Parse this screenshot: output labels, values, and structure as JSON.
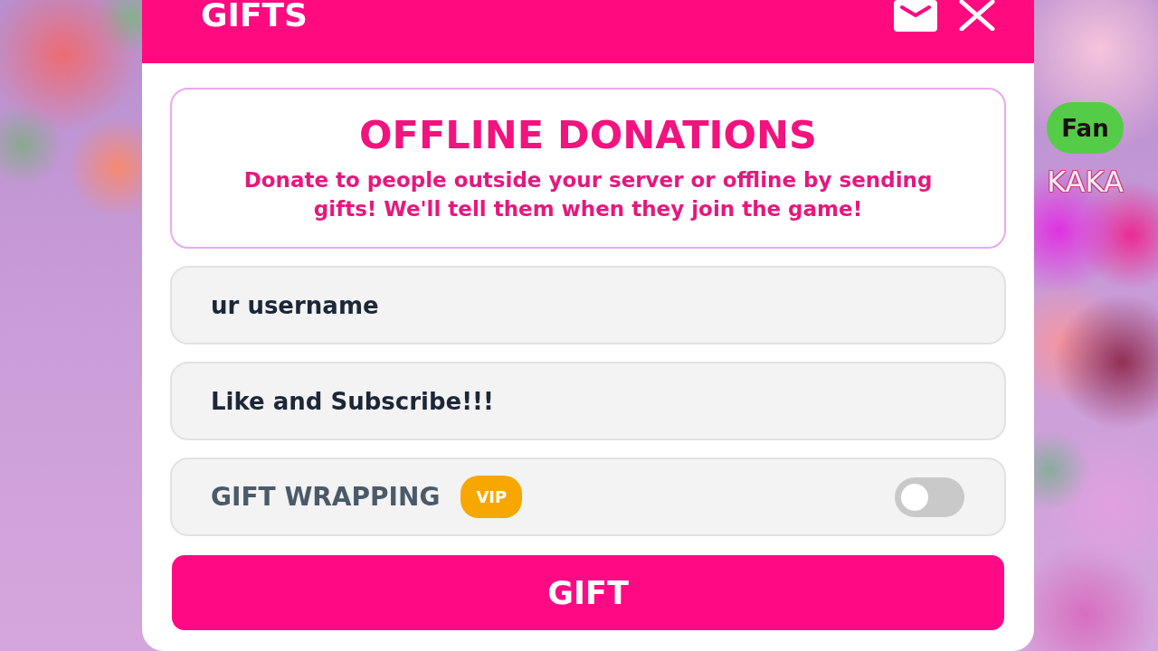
{
  "dialog": {
    "title": "GIFTS",
    "info": {
      "title": "OFFLINE DONATIONS",
      "text": "Donate to people outside your server or offline by sending gifts! We'll tell them when they join the game!"
    },
    "fields": [
      {
        "value": "ur username"
      },
      {
        "value": "Like and Subscribe!!!"
      }
    ],
    "gift_wrapping": {
      "label": "GIFT WRAPPING",
      "badge": "VIP",
      "on": false
    },
    "button": "GIFT"
  },
  "nameplate": {
    "badge": "Fan",
    "name": "KAKA"
  }
}
